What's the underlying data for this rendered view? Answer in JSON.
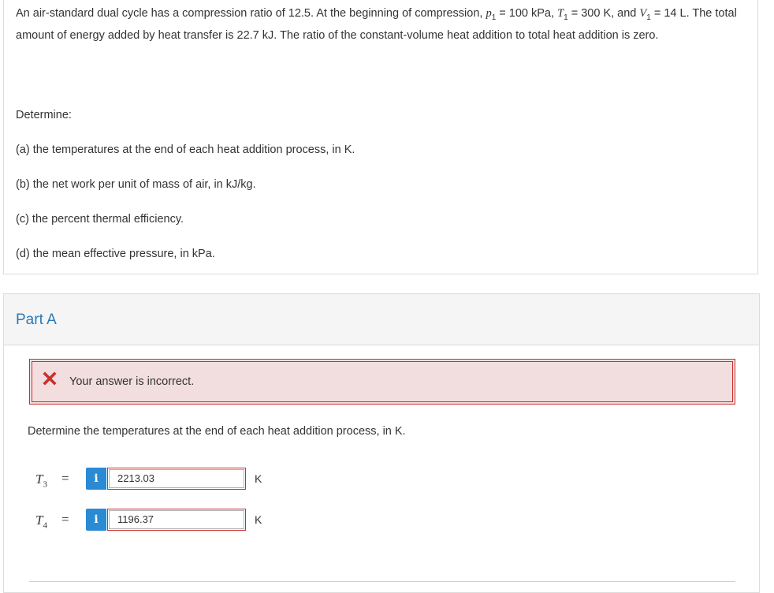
{
  "problem": {
    "intro_a": "An air-standard dual cycle has a compression ratio of 12.5. At the beginning of compression, ",
    "p1_sym": "p",
    "p1_sub": "1",
    "p1_val": " = 100 kPa, ",
    "T1_sym": "T",
    "T1_sub": "1",
    "T1_val": " = 300 K, and ",
    "V1_sym": "V",
    "V1_sub": "1",
    "V1_val": " = 14 L.",
    "intro_b": " The total amount of energy added by heat transfer is 22.7 kJ. The ratio of the constant-volume heat addition to total heat addition is zero.",
    "determine": "Determine:",
    "items": [
      "(a) the temperatures at the end of each heat addition process, in K.",
      "(b) the net work per unit of mass of air, in kJ/kg.",
      "(c) the percent thermal efficiency.",
      "(d) the mean effective pressure, in kPa."
    ]
  },
  "part_a": {
    "title": "Part A",
    "feedback": "Your answer is incorrect.",
    "question": "Determine the temperatures at the end of each heat addition process, in K.",
    "answers": [
      {
        "symbol": "T",
        "sub": "3",
        "eq": "=",
        "info": "i",
        "value": "2213.03",
        "unit": "K"
      },
      {
        "symbol": "T",
        "sub": "4",
        "eq": "=",
        "info": "i",
        "value": "1196.37",
        "unit": "K"
      }
    ]
  },
  "colors": {
    "error_border": "#c9302c",
    "error_bg": "#f2dede",
    "info_blue": "#2a8ad4",
    "title_blue": "#2a7ab9"
  }
}
